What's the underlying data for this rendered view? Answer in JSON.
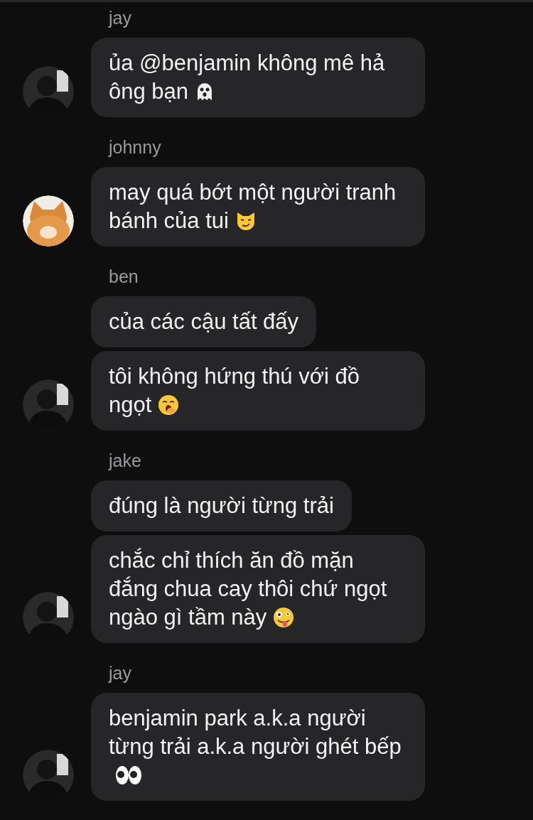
{
  "groups": [
    {
      "sender": "jay",
      "messages": [
        {
          "text": "ủa @benjamin không mê hả ông bạn",
          "kind": "ghost"
        }
      ]
    },
    {
      "sender": "johnny",
      "messages": [
        {
          "text": "may quá bớt một người tranh bánh của tui",
          "kind": "smirk-cat"
        }
      ]
    },
    {
      "sender": "ben",
      "messages": [
        {
          "text": "của các cậu tất đấy",
          "kind": "plain"
        },
        {
          "text": "tôi không hứng thú với đồ ngọt",
          "kind": "yawn"
        }
      ]
    },
    {
      "sender": "jake",
      "messages": [
        {
          "text": "đúng là người từng trải",
          "kind": "plain"
        },
        {
          "text": "chắc chỉ thích ăn đồ mặn đắng chua cay thôi chứ ngọt ngào gì tầm này",
          "kind": "zany"
        }
      ]
    },
    {
      "sender": "jay",
      "messages": [
        {
          "text": "benjamin park a.k.a người từng trải a.k.a người ghét bếp",
          "kind": "eyes"
        }
      ]
    }
  ]
}
